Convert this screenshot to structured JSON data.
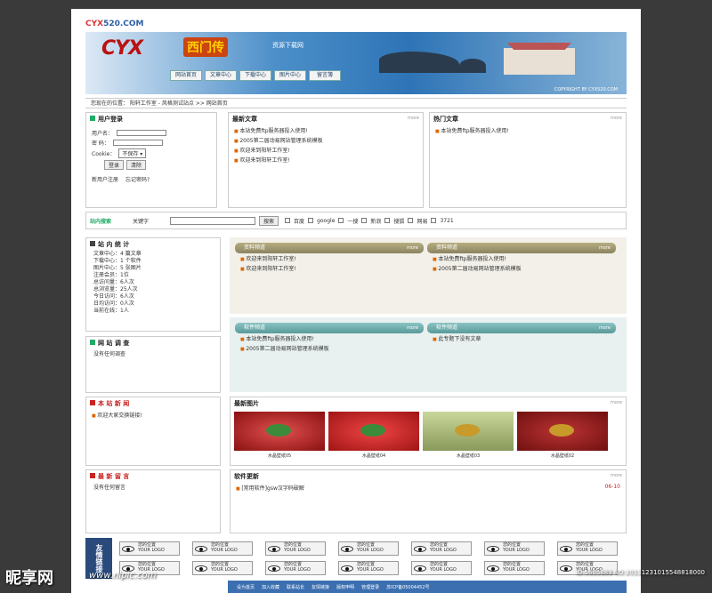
{
  "site": {
    "domain_prefix": "CYX",
    "domain_suffix": "520.COM",
    "logo": "CYX",
    "logo_cn": "西门传",
    "tagline": "资源下载网",
    "copyright": "COPYRIGHT BY CYX520.COM"
  },
  "nav": [
    "网站首页",
    "文章中心",
    "下载中心",
    "图片中心",
    "留言簿"
  ],
  "breadcrumb": "您现在的位置： 阳轩工作室 - 风格测试站点 >> 网站首页",
  "login": {
    "title": "用户登录",
    "user_label": "用户名：",
    "pass_label": "密 码：",
    "cookie_label": "Cookie：",
    "cookie_value": "不保存",
    "login_btn": "登录",
    "clear_btn": "清除",
    "register": "新用户注册",
    "forgot": "忘记密码?"
  },
  "latest": {
    "title": "最新文章",
    "more": "more",
    "items": [
      "本站免费ftp服务器投入使用!",
      "2005第二届动易网站管理系统模板",
      "欢迎来到阳轩工作室!",
      "欢迎来到阳轩工作室!"
    ]
  },
  "hot": {
    "title": "热门文章",
    "more": "more",
    "items": [
      "本站免费ftp服务器投入使用!"
    ]
  },
  "search": {
    "brand": "站内搜索",
    "label": "关键字",
    "button": "搜索",
    "engines": [
      "百度",
      "google",
      "一搜",
      "新浪",
      "搜狐",
      "网易",
      "3721"
    ]
  },
  "stats": {
    "title": "站 内 统 计",
    "items": [
      "文章中心：4 篇文章",
      "下载中心：1 个软件",
      "图片中心：5 张图片",
      "注册会员：1位",
      "总访问量：6人次",
      "总浏览量：25人次",
      "今日访问：6人次",
      "日均访问：0人次",
      "当前在线：1人"
    ]
  },
  "survey": {
    "title": "网 站 调 查",
    "text": "没有任何调查"
  },
  "news": {
    "title": "本 站 新 闻",
    "text": "欢迎大家交换链接!"
  },
  "guestbook": {
    "title": "最 新 留 言",
    "text": "没有任何留言"
  },
  "panels": [
    {
      "title": "资料频道",
      "more": "more",
      "items": [
        "欢迎来到阳轩工作室!",
        "欢迎来到阳轩工作室!"
      ]
    },
    {
      "title": "资料频道",
      "more": "more",
      "items": [
        "本站免费ftp服务器投入使用!",
        "2005第二届动易网站管理系统模板"
      ]
    },
    {
      "title": "软件频道",
      "more": "more",
      "items": [
        "本站免费ftp服务器投入使用!",
        "2005第二届动易网站管理系统模板"
      ]
    },
    {
      "title": "软件频道",
      "more": "more",
      "items": [
        "此专题下没有文章"
      ]
    }
  ],
  "pictures": {
    "title": "最新图片",
    "more": "more",
    "items": [
      "水晶壁纸05",
      "水晶壁纸04",
      "水晶壁纸03",
      "水晶壁纸02"
    ]
  },
  "software": {
    "title": "软件更新",
    "more": "more",
    "item": "[常用软件]gsw汉字码破解",
    "date": "06-10"
  },
  "links": {
    "title": "友情链接",
    "label": "您的位置",
    "sublabel": "YOUR LOGO"
  },
  "footer": {
    "items": [
      "设为首页",
      "加入收藏",
      "联系站长",
      "友情链接",
      "版权申明",
      "管理登录"
    ],
    "icp": "苏ICP备05004452号"
  },
  "watermark": {
    "left": "昵享网",
    "url": "www.nipic.com",
    "id": "ID:5605889 NO:20131231015548818000"
  }
}
